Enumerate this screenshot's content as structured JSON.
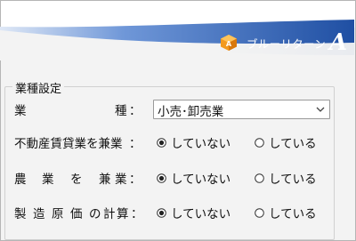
{
  "brand": {
    "name": "ブルーリターン",
    "mark": "A"
  },
  "group": {
    "title": "業種設定"
  },
  "industry": {
    "label_chars": [
      "業",
      "種"
    ],
    "colon": "：",
    "selected": "小売･卸売業"
  },
  "rows": [
    {
      "label": "不動産賃貸業を兼業",
      "colon": "：",
      "options": [
        "していない",
        "している"
      ],
      "selected_index": 0
    },
    {
      "label_chars": [
        "農",
        "業",
        "を",
        "兼",
        "業"
      ],
      "colon": "：",
      "options": [
        "していない",
        "している"
      ],
      "selected_index": 0
    },
    {
      "label_chars": [
        "製",
        "造",
        "原",
        "価",
        "の",
        "計",
        "算"
      ],
      "colon": "：",
      "options": [
        "していない",
        "している"
      ],
      "selected_index": 0
    }
  ],
  "colors": {
    "banner_dark": "#1f4fa3",
    "banner_light": "#5b86cf",
    "accent_orange": "#f0a020"
  }
}
